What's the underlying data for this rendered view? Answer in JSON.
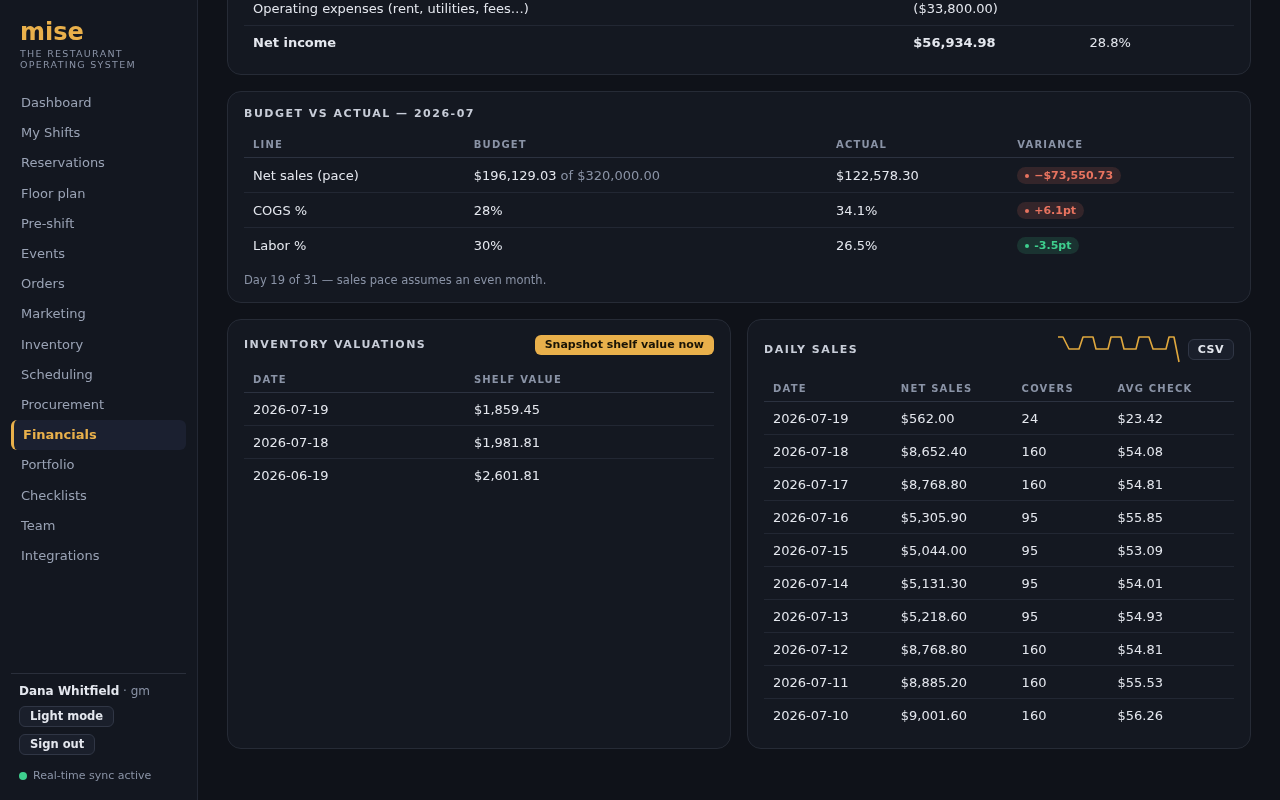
{
  "sidebar": {
    "logo": "mise",
    "tagline": "THE RESTAURANT OPERATING SYSTEM",
    "nav": [
      {
        "label": "Dashboard",
        "selected": false
      },
      {
        "label": "My Shifts",
        "selected": false
      },
      {
        "label": "Reservations",
        "selected": false
      },
      {
        "label": "Floor plan",
        "selected": false
      },
      {
        "label": "Pre-shift",
        "selected": false
      },
      {
        "label": "Events",
        "selected": false
      },
      {
        "label": "Orders",
        "selected": false
      },
      {
        "label": "Marketing",
        "selected": false
      },
      {
        "label": "Inventory",
        "selected": false
      },
      {
        "label": "Scheduling",
        "selected": false
      },
      {
        "label": "Procurement",
        "selected": false
      },
      {
        "label": "Financials",
        "selected": true
      },
      {
        "label": "Portfolio",
        "selected": false
      },
      {
        "label": "Checklists",
        "selected": false
      },
      {
        "label": "Team",
        "selected": false
      },
      {
        "label": "Integrations",
        "selected": false
      }
    ],
    "user": {
      "name": "Dana Whitfield",
      "role": "· gm"
    },
    "buttons": [
      "Light mode",
      "Sign out"
    ],
    "sync_status": {
      "label": "Real-time sync active",
      "on": true
    }
  },
  "income_statement": {
    "rows": [
      {
        "kind": "line",
        "label": "Operating expenses (rent, utilities, fees…)",
        "amount": "($33,800.00)"
      },
      {
        "kind": "total",
        "label": "Net income",
        "amount": "$56,934.98",
        "share": "28.8%"
      }
    ]
  },
  "budget_vs_actual": {
    "title": "BUDGET VS ACTUAL — 2026-07",
    "columns": [
      "LINE",
      "BUDGET",
      "ACTUAL",
      "VARIANCE"
    ],
    "rows": [
      {
        "line": "Net sales (pace)",
        "budget": "$196,129.03",
        "budget_note": "of $320,000.00",
        "actual": "$122,578.30",
        "variance": "−$73,550.73",
        "color": "#e8735f"
      },
      {
        "line": "COGS %",
        "budget": "28%",
        "actual": "34.1%",
        "variance": "+6.1pt",
        "color": "#e8735f"
      },
      {
        "line": "Labor %",
        "budget": "30%",
        "actual": "26.5%",
        "variance": "-3.5pt",
        "color": "#3ecf8e"
      }
    ],
    "footnote": "Day 19 of 31 — sales pace assumes an even month."
  },
  "inventory_valuations": {
    "title": "INVENTORY VALUATIONS",
    "action": "Snapshot shelf value now",
    "columns": [
      "DATE",
      "SHELF VALUE"
    ],
    "rows": [
      [
        "2026-07-19",
        "$1,859.45"
      ],
      [
        "2026-07-18",
        "$1,981.81"
      ],
      [
        "2026-06-19",
        "$2,601.81"
      ]
    ]
  },
  "daily_sales": {
    "title": "DAILY SALES",
    "action": "CSV",
    "columns": [
      "DATE",
      "NET SALES",
      "COVERS",
      "AVG CHECK"
    ],
    "rows": [
      [
        "2026-07-19",
        "$562.00",
        "24",
        "$23.42"
      ],
      [
        "2026-07-18",
        "$8,652.40",
        "160",
        "$54.08"
      ],
      [
        "2026-07-17",
        "$8,768.80",
        "160",
        "$54.81"
      ],
      [
        "2026-07-16",
        "$5,305.90",
        "95",
        "$55.85"
      ],
      [
        "2026-07-15",
        "$5,044.00",
        "95",
        "$53.09"
      ],
      [
        "2026-07-14",
        "$5,131.30",
        "95",
        "$54.01"
      ],
      [
        "2026-07-13",
        "$5,218.60",
        "95",
        "$54.93"
      ],
      [
        "2026-07-12",
        "$8,768.80",
        "160",
        "$54.81"
      ],
      [
        "2026-07-11",
        "$8,885.20",
        "160",
        "$55.53"
      ],
      [
        "2026-07-10",
        "$9,001.60",
        "160",
        "$56.26"
      ]
    ]
  }
}
